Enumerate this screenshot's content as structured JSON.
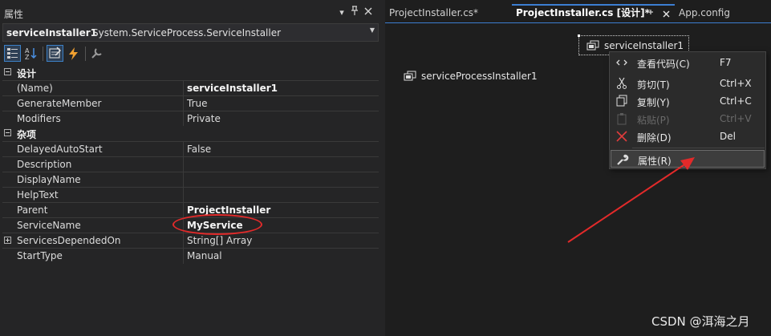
{
  "properties_panel": {
    "title": "属性",
    "title_buttons": [
      "chevron-down-icon",
      "pin-icon",
      "close-icon"
    ],
    "object_name": "serviceInstaller1",
    "object_type": "System.ServiceProcess.ServiceInstaller",
    "toolbar": [
      "categorized-icon",
      "alphabetical-icon",
      "properties-icon",
      "events-icon",
      "property-pages-icon"
    ],
    "categories": [
      {
        "name": "设计",
        "rows": [
          {
            "name": "(Name)",
            "value": "serviceInstaller1",
            "bold": true
          },
          {
            "name": "GenerateMember",
            "value": "True",
            "bold": false
          },
          {
            "name": "Modifiers",
            "value": "Private",
            "bold": false
          }
        ]
      },
      {
        "name": "杂项",
        "rows": [
          {
            "name": "DelayedAutoStart",
            "value": "False",
            "bold": false
          },
          {
            "name": "Description",
            "value": "",
            "bold": false
          },
          {
            "name": "DisplayName",
            "value": "",
            "bold": false
          },
          {
            "name": "HelpText",
            "value": "",
            "bold": false
          },
          {
            "name": "Parent",
            "value": "ProjectInstaller",
            "bold": true
          },
          {
            "name": "ServiceName",
            "value": "MyService",
            "bold": true
          },
          {
            "name": "ServicesDependedOn",
            "value": "String[] Array",
            "bold": false,
            "expandable": true
          },
          {
            "name": "StartType",
            "value": "Manual",
            "bold": false
          }
        ]
      }
    ]
  },
  "tabs": [
    {
      "label": "ProjectInstaller.cs*",
      "active": false
    },
    {
      "label": "ProjectInstaller.cs [设计]*",
      "active": true
    },
    {
      "label": "App.config",
      "active": false
    }
  ],
  "designer": {
    "components": [
      "serviceProcessInstaller1",
      "serviceInstaller1"
    ]
  },
  "context_menu": {
    "items": [
      {
        "label": "查看代码(C)",
        "shortcut": "F7",
        "icon": "code-icon",
        "disabled": false
      },
      {
        "label": "剪切(T)",
        "shortcut": "Ctrl+X",
        "icon": "scissors-icon",
        "disabled": false
      },
      {
        "label": "复制(Y)",
        "shortcut": "Ctrl+C",
        "icon": "copy-icon",
        "disabled": false
      },
      {
        "label": "粘贴(P)",
        "shortcut": "Ctrl+V",
        "icon": "paste-icon",
        "disabled": true
      },
      {
        "label": "删除(D)",
        "shortcut": "Del",
        "icon": "delete-icon",
        "disabled": false
      },
      {
        "label": "属性(R)",
        "shortcut": "",
        "icon": "wrench-icon",
        "disabled": false,
        "highlighted": true
      }
    ]
  },
  "annotation_color": "#e22a2a",
  "watermark": "CSDN @洱海之月"
}
